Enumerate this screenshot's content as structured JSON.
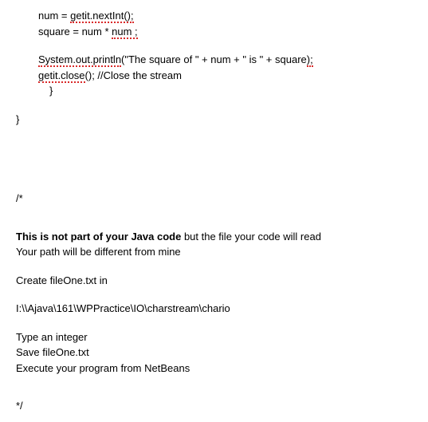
{
  "code": {
    "line1_pre": "num = ",
    "line1_sq": "getit.nextInt();",
    "line2_pre": "square = num * ",
    "line2_sq": "num ;",
    "line3_sq_a": "System.out.println",
    "line3_mid": "(\"The square of \" + num + \" is \" + square",
    "line3_sq_b": ");",
    "line4_sq": "getit.close",
    "line4_rest": "(); //Close the stream",
    "line5": "}",
    "line6": "}",
    "comment_open": "/*"
  },
  "instr": {
    "p1_bold": "This is not part of your Java code",
    "p1_rest": " but the file your code will read",
    "p2": "Your path will be different from mine",
    "p3": "Create fileOne.txt in",
    "p4": "I:\\\\Ajava\\161\\WPPractice\\IO\\charstream\\chario",
    "p5": "Type an integer",
    "p6": "Save fileOne.txt",
    "p7": "Execute your program from NetBeans",
    "comment_close": "*/"
  }
}
